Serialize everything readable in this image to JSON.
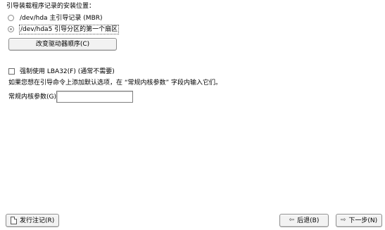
{
  "bootloader": {
    "heading": "引导装载程序记录的安装位置：",
    "options": [
      {
        "label": "/dev/hda 主引导记录 (MBR)",
        "selected": false
      },
      {
        "label": "/dev/hda5 引导分区的第一个扇区",
        "selected": true
      }
    ],
    "change_drive_order_button": "改变驱动器顺序(C)"
  },
  "lba32": {
    "checkbox_label": "强制使用 LBA32(F) (通常不需要)",
    "checked": false
  },
  "kernel": {
    "hint": "如果您想在引导命令上添加默认选项，在 “常规内核参数” 字段内输入它们。",
    "params_label": "常规内核参数(G)",
    "params_value": ""
  },
  "footer": {
    "release_notes_button": "发行注记(R)",
    "back_button": "后退(B)",
    "next_button": "下一步(N)",
    "back_icon": "arrow-left-icon",
    "next_icon": "arrow-right-icon",
    "release_notes_icon": "document-icon"
  }
}
